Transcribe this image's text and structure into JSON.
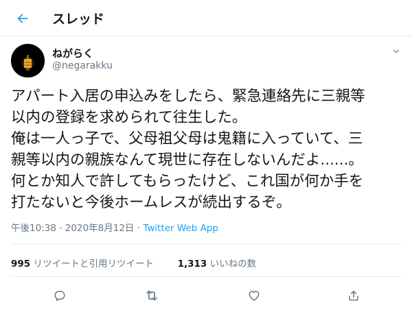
{
  "header": {
    "title": "スレッド",
    "back_icon": "back-arrow-icon",
    "accent": "#1da1f2"
  },
  "author": {
    "display_name": "ねがらく",
    "handle": "@negarakku"
  },
  "tweet": {
    "lines": [
      "アパート入居の申込みをしたら、緊急連絡先に三親等",
      "以内の登録を求められて往生した。",
      "俺は一人っ子で、父母祖父母は鬼籍に入っていて、三",
      "親等以内の親族なんて現世に存在しないんだよ......。",
      "何とか知人で許してもらったけど、これ国が何か手を",
      "打たないと今後ホームレスが続出するぞ。"
    ],
    "time": "午後10:38",
    "date": "2020年8月12日",
    "separator": "·",
    "source": "Twitter Web App"
  },
  "stats": {
    "retweets_count": "995",
    "retweets_label": "リツイートと引用リツイート",
    "likes_count": "1,313",
    "likes_label": "いいねの数"
  },
  "actions": {
    "icons": [
      "reply-icon",
      "retweet-icon",
      "like-icon",
      "share-icon"
    ]
  }
}
